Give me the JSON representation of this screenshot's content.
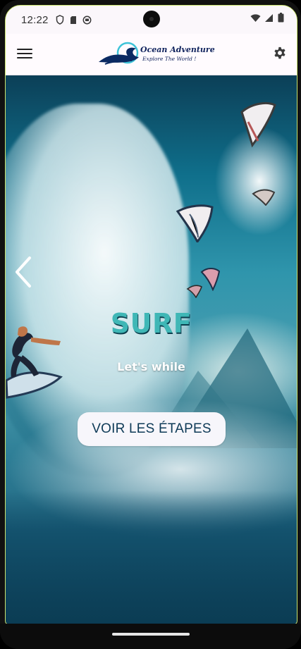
{
  "status_bar": {
    "time": "12:22",
    "left_icons": [
      "shield-icon",
      "sd-card-icon",
      "app-notification-icon"
    ],
    "right_icons": [
      "wifi-icon",
      "signal-icon",
      "battery-icon"
    ]
  },
  "header": {
    "menu_icon": "menu-icon",
    "logo": {
      "title": "Ocean Adventure",
      "tagline": "Explore The World !"
    },
    "settings_icon": "gear-icon"
  },
  "hero": {
    "title": "SURF",
    "subtitle": "Let's while",
    "cta_label": "VOIR LES ÉTAPES",
    "prev_icon": "chevron-left-icon",
    "colors": {
      "title": "#3fb7b6",
      "button_bg": "#f7f6fb",
      "button_text": "#0e3a57"
    }
  },
  "system_nav": {
    "home_indicator": "home-indicator"
  }
}
